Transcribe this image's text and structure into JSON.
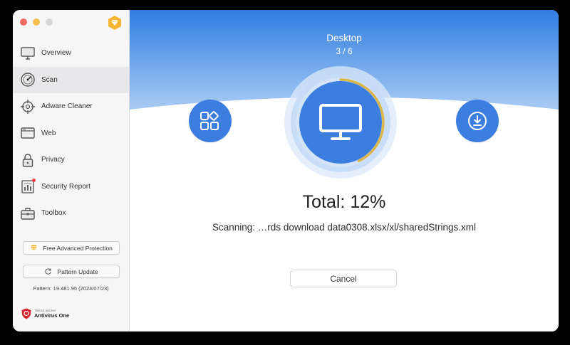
{
  "colors": {
    "hero_top": "#2f7de1",
    "hero_bottom": "#a9cbf3",
    "accent_blue": "#3c7ee0",
    "progress_gold": "#d9b64b",
    "sidebar_bg": "#f6f6f7"
  },
  "sidebar": {
    "items": [
      {
        "label": "Overview",
        "icon": "monitor-icon",
        "active": false
      },
      {
        "label": "Scan",
        "icon": "gauge-icon",
        "active": true
      },
      {
        "label": "Adware Cleaner",
        "icon": "crosshair-icon",
        "active": false
      },
      {
        "label": "Web",
        "icon": "browser-window-icon",
        "active": false
      },
      {
        "label": "Privacy",
        "icon": "lock-icon",
        "active": false
      },
      {
        "label": "Security Report",
        "icon": "report-chart-icon",
        "active": false
      },
      {
        "label": "Toolbox",
        "icon": "toolbox-icon",
        "active": false
      }
    ],
    "advanced_label": "Free Advanced Protection",
    "update_label": "Pattern Update",
    "pattern_info": "Pattern: 19.481.95 (2024/07/23)",
    "brand_small": "TREND MICRO",
    "brand_name": "Antivirus One"
  },
  "scan": {
    "location": "Desktop",
    "progress_count": "3 / 6",
    "total": "Total: 12%",
    "current_fraction": 0.43,
    "scanning_text": "Scanning: …rds download data0308.xlsx/xl/sharedStrings.xml",
    "cancel_label": "Cancel"
  }
}
